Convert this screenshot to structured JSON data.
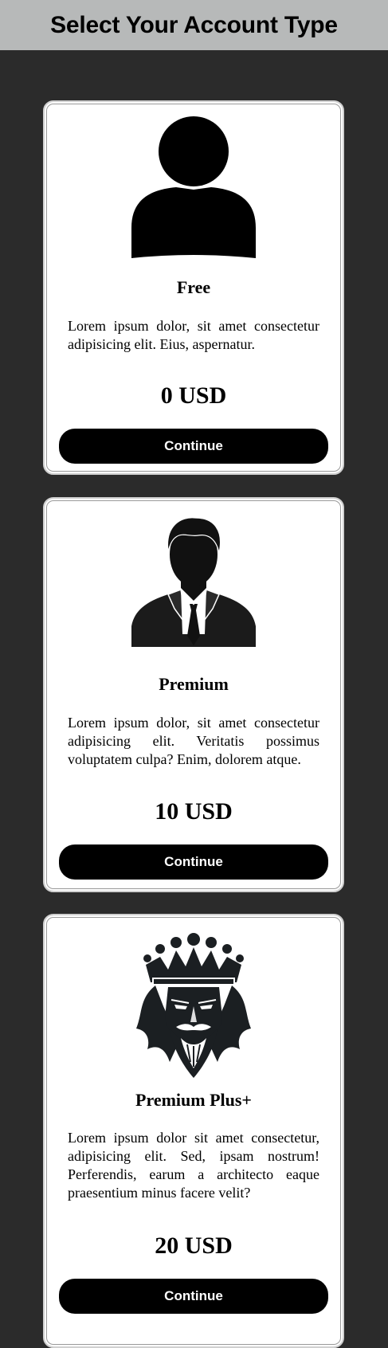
{
  "header": {
    "title": "Select Your Account Type"
  },
  "plans": [
    {
      "icon": "user-icon",
      "name": "Free",
      "description": "Lorem ipsum dolor, sit amet consectetur adipisicing elit. Eius, aspernatur.",
      "price": "0 USD",
      "button_label": "Continue"
    },
    {
      "icon": "businessman-icon",
      "name": "Premium",
      "description": "Lorem ipsum dolor, sit amet consectetur adipisicing elit. Veritatis possimus voluptatem culpa? Enim, dolorem atque.",
      "price": "10 USD",
      "button_label": "Continue"
    },
    {
      "icon": "king-icon",
      "name": "Premium Plus+",
      "description": "Lorem ipsum dolor sit amet consectetur, adipisicing elit. Sed, ipsam nostrum! Perferendis, earum a architecto eaque praesentium minus facere velit?",
      "price": "20 USD",
      "button_label": "Continue"
    }
  ]
}
